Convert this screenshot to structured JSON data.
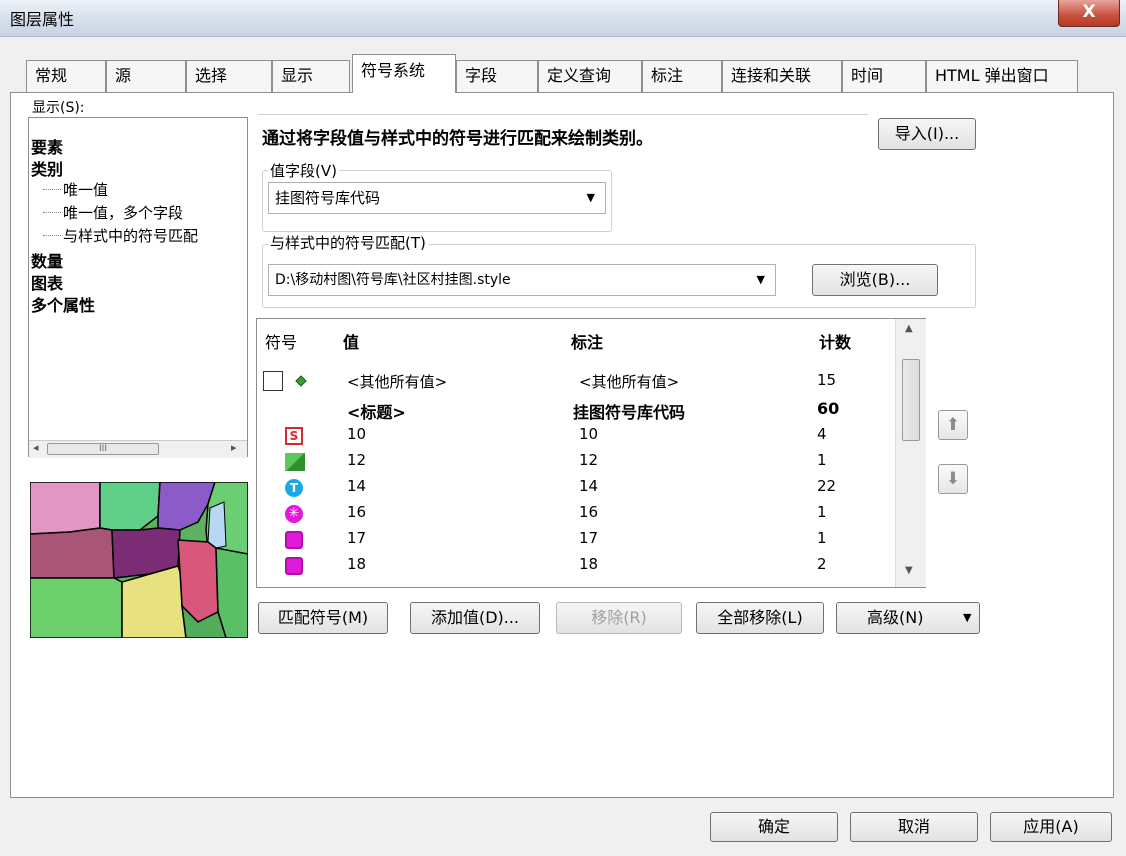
{
  "window": {
    "title": "图层属性",
    "close_label": "X"
  },
  "tabs": [
    {
      "label": "常规"
    },
    {
      "label": "源"
    },
    {
      "label": "选择"
    },
    {
      "label": "显示"
    },
    {
      "label": "符号系统"
    },
    {
      "label": "字段"
    },
    {
      "label": "定义查询"
    },
    {
      "label": "标注"
    },
    {
      "label": "连接和关联"
    },
    {
      "label": "时间"
    },
    {
      "label": "HTML 弹出窗口"
    }
  ],
  "left": {
    "show_label": "显示(S):",
    "tree": [
      {
        "label": "要素"
      },
      {
        "label": "类别"
      },
      {
        "label": "唯一值"
      },
      {
        "label": "唯一值，多个字段"
      },
      {
        "label": "与样式中的符号匹配"
      },
      {
        "label": "数量"
      },
      {
        "label": "图表"
      },
      {
        "label": "多个属性"
      }
    ],
    "scroll_thumb": "III"
  },
  "main": {
    "description": "通过将字段值与样式中的符号进行匹配来绘制类别。",
    "import_button": "导入(I)...",
    "value_field": {
      "label": "值字段(V)",
      "value": "挂图符号库代码"
    },
    "style_match": {
      "label": "与样式中的符号匹配(T)",
      "value": "D:\\移动村图\\符号库\\社区村挂图.style"
    },
    "browse_button": "浏览(B)..."
  },
  "grid": {
    "headers": {
      "symbol": "符号",
      "value": "值",
      "label": "标注",
      "count": "计数"
    },
    "rows": [
      {
        "value": "<其他所有值>",
        "label": "<其他所有值>",
        "count": "15"
      },
      {
        "value": "<标题>",
        "label": "挂图符号库代码",
        "count": "60"
      },
      {
        "value": "10",
        "label": "10",
        "count": "4"
      },
      {
        "value": "12",
        "label": "12",
        "count": "1"
      },
      {
        "value": "14",
        "label": "14",
        "count": "22"
      },
      {
        "value": "16",
        "label": "16",
        "count": "1"
      },
      {
        "value": "17",
        "label": "17",
        "count": "1"
      },
      {
        "value": "18",
        "label": "18",
        "count": "2"
      }
    ]
  },
  "actions": {
    "match": "匹配符号(M)",
    "add": "添加值(D)...",
    "remove": "移除(R)",
    "remove_all": "全部移除(L)",
    "advanced": "高级(N)"
  },
  "footer": {
    "ok": "确定",
    "cancel": "取消",
    "apply": "应用(A)"
  },
  "colors": {
    "accent": "#c7503c",
    "sym_s": "#d9262f",
    "sym_cyan": "#1aa9e6",
    "sym_magenta": "#e01ad8",
    "sym_green": "#4cb04c"
  }
}
